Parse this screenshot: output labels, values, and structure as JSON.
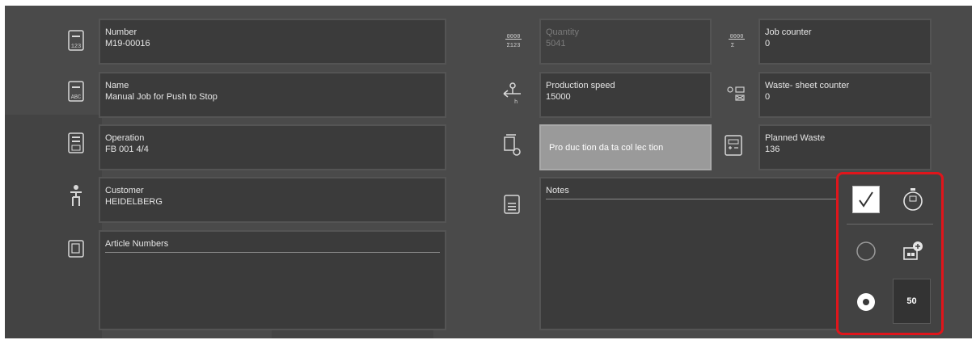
{
  "fields": {
    "number": {
      "label": "Number",
      "value": "M19-00016"
    },
    "name": {
      "label": "Name",
      "value": "Manual Job for Push to Stop"
    },
    "operation": {
      "label": "Operation",
      "value": "FB 001  4/4"
    },
    "customer": {
      "label": "Customer",
      "value": "HEIDELBERG"
    },
    "article_numbers": {
      "label": "Article Numbers"
    },
    "quantity": {
      "label": "Quantity",
      "value": "5041"
    },
    "production_speed": {
      "label": "Production speed",
      "value": "15000"
    },
    "production_data_collection": {
      "label": "Pro duc tion da ta col lec tion"
    },
    "notes": {
      "label": "Notes"
    },
    "job_counter": {
      "label": "Job counter",
      "value": "0"
    },
    "waste_sheet_counter": {
      "label": "Waste- sheet counter",
      "value": "0"
    },
    "planned_waste": {
      "label": "Planned Waste",
      "value": "136"
    }
  },
  "icons": {
    "number": "id-card-123-icon",
    "name": "id-card-abc-icon",
    "operation": "operation-document-icon",
    "customer": "customer-person-icon",
    "article": "article-document-icon",
    "quantity": "quantity-sum-icon",
    "speed": "production-speed-icon",
    "data_collection": "data-collection-icon",
    "notes": "notes-icon",
    "job_counter": "job-counter-icon",
    "waste_counter": "waste-counter-icon",
    "planned_waste": "planned-waste-icon"
  },
  "icon_text": {
    "n123": "123",
    "abc": "ABC",
    "qty_top": "0000",
    "qty_bot": "Σ123",
    "job_top": "0000",
    "job_bot": "Σ"
  },
  "controls": {
    "checkbox_checked": true,
    "stopwatch_icon": "stopwatch-icon",
    "radio_unselected_icon": "radio-unselected-icon",
    "radio_selected_icon": "radio-selected-icon",
    "pallet_icon": "pallet-add-icon",
    "value": "50"
  },
  "colors": {
    "highlight_border": "#e0151b",
    "panel_bg": "#4a4a4a",
    "field_bg": "#3b3b3b",
    "button_light": "#9a9a9a"
  }
}
